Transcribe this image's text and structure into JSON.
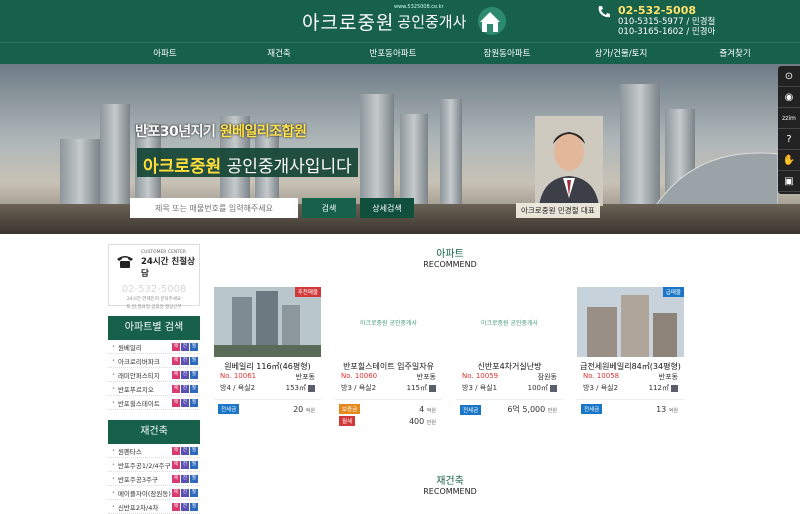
{
  "header": {
    "logo_brand": "아크로중원",
    "logo_sub": "공인중개사",
    "logo_url": "www.5325008.co.kr",
    "phone_main": "02-532-5008",
    "phone_1": "010-5315-5977 / 민경철",
    "phone_2": "010-3165-1602 / 민경아",
    "colors": {
      "brand": "#17604a",
      "accent": "#ffe36e"
    }
  },
  "nav": {
    "items": [
      "아파트",
      "재건축",
      "반포동아파트",
      "잠원동아파트",
      "상가/건물/토지",
      "즐겨찾기"
    ]
  },
  "hero": {
    "ribbon_pre": "반포30년지기 ",
    "ribbon_hl": "원베일리조합원",
    "tag_hl": "아크로중원",
    "tag_rest": " 공인중개사입니다",
    "search_placeholder": "제목 또는 매물번호를 입력해주세요",
    "search_button": "검색",
    "detail_button": "상세검색",
    "agent_caption": "아크로중원 민경철 대표"
  },
  "tools": {
    "icons": [
      "scroll-up-icon",
      "view-icon",
      "zzim-icon",
      "help-icon",
      "handshake-icon",
      "briefcase-icon"
    ],
    "zzim_label": "zzim"
  },
  "sidebar": {
    "cc_label": "CUSTOMER CENTER",
    "cc_title": "24시간 친절상담",
    "cc_phone": "02-532-5008",
    "cc_small_1": "24시간 언제든지 문의주세요",
    "cc_small_2": "토,일,일요일,공휴일 정상근무",
    "sections": [
      {
        "title": "아파트별 검색",
        "items": [
          "원베일리",
          "아크로리버파크",
          "래미안퍼스티지",
          "반포푸르지오",
          "반포힐스테이트"
        ]
      },
      {
        "title": "재건축",
        "items": [
          "원펜타스",
          "반포주공1/2/4주구",
          "반포주공3주구",
          "메이플자이(잠원동)",
          "신반포2차/4차"
        ]
      }
    ],
    "box_labels": [
      "매",
      "전",
      "월"
    ]
  },
  "main": {
    "title": "아파트",
    "subtitle": "RECOMMEND",
    "section2_title": "재건축",
    "section2_subtitle": "RECOMMEND",
    "cards": [
      {
        "badge": "추천매물",
        "badge_color": "#d23a3a",
        "image": "photo",
        "name": "원베일리 116㎡(46평형)",
        "no": "No. 10061",
        "loc": "반포동",
        "rooms": "방4 / 욕실2",
        "area": "153㎡",
        "prices": [
          {
            "tag": "전세금",
            "tag_color": "#1a76c6",
            "value": "20",
            "unit": "억원"
          }
        ]
      },
      {
        "badge": "",
        "badge_color": "",
        "image": "logo",
        "logo_text": "아크로중원 공인중개사",
        "name": "반포힐스테이트 입주일자유",
        "no": "No. 10060",
        "loc": "반포동",
        "rooms": "방3 / 욕실2",
        "area": "115㎡",
        "prices": [
          {
            "tag": "보증금",
            "tag_color": "#e38a1e",
            "value": "4",
            "unit": "억원"
          },
          {
            "tag": "월세",
            "tag_color": "#d23a3a",
            "value": "400",
            "unit": "만원"
          }
        ]
      },
      {
        "badge": "",
        "badge_color": "",
        "image": "logo",
        "logo_text": "아크로중원 공인중개사",
        "name": "신반포4차거실난방",
        "no": "No. 10059",
        "loc": "잠원동",
        "rooms": "방3 / 욕실1",
        "area": "100㎡",
        "prices": [
          {
            "tag": "전세금",
            "tag_color": "#1a76c6",
            "value": "6억 5,000",
            "unit": "만원"
          }
        ]
      },
      {
        "badge": "급매물",
        "badge_color": "#1a76c6",
        "image": "photo",
        "name": "급전세원베일리84㎡(34평형)",
        "no": "No. 10058",
        "loc": "반포동",
        "rooms": "방3 / 욕실2",
        "area": "112㎡",
        "prices": [
          {
            "tag": "전세금",
            "tag_color": "#1a76c6",
            "value": "13",
            "unit": "억원"
          }
        ]
      }
    ]
  }
}
